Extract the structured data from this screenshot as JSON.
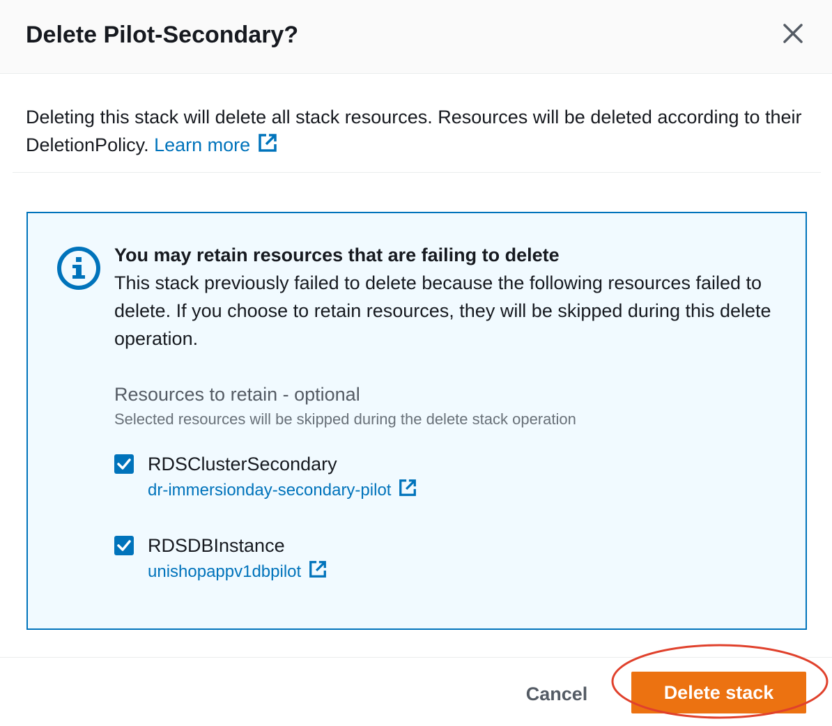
{
  "dialog": {
    "title": "Delete Pilot-Secondary?",
    "close_icon": "close-icon",
    "description": "Deleting this stack will delete all stack resources. Resources will be deleted according to their DeletionPolicy.",
    "learn_more_label": "Learn more"
  },
  "alert": {
    "icon": "info-icon",
    "title": "You may retain resources that are failing to delete",
    "body": "This stack previously failed to delete because the following resources failed to delete. If you choose to retain resources, they will be skipped during this delete operation.",
    "field_label": "Resources to retain - optional",
    "field_description": "Selected resources will be skipped during the delete stack operation",
    "resources": [
      {
        "name": "RDSClusterSecondary",
        "link": "dr-immersionday-secondary-pilot",
        "checked": true
      },
      {
        "name": "RDSDBInstance",
        "link": "unishopappv1dbpilot",
        "checked": true
      }
    ]
  },
  "footer": {
    "cancel_label": "Cancel",
    "delete_label": "Delete stack"
  },
  "colors": {
    "link": "#0073bb",
    "primary_button": "#ec7211",
    "alert_border": "#0073bb",
    "alert_background": "#f1faff",
    "annotation": "#e0412c"
  }
}
